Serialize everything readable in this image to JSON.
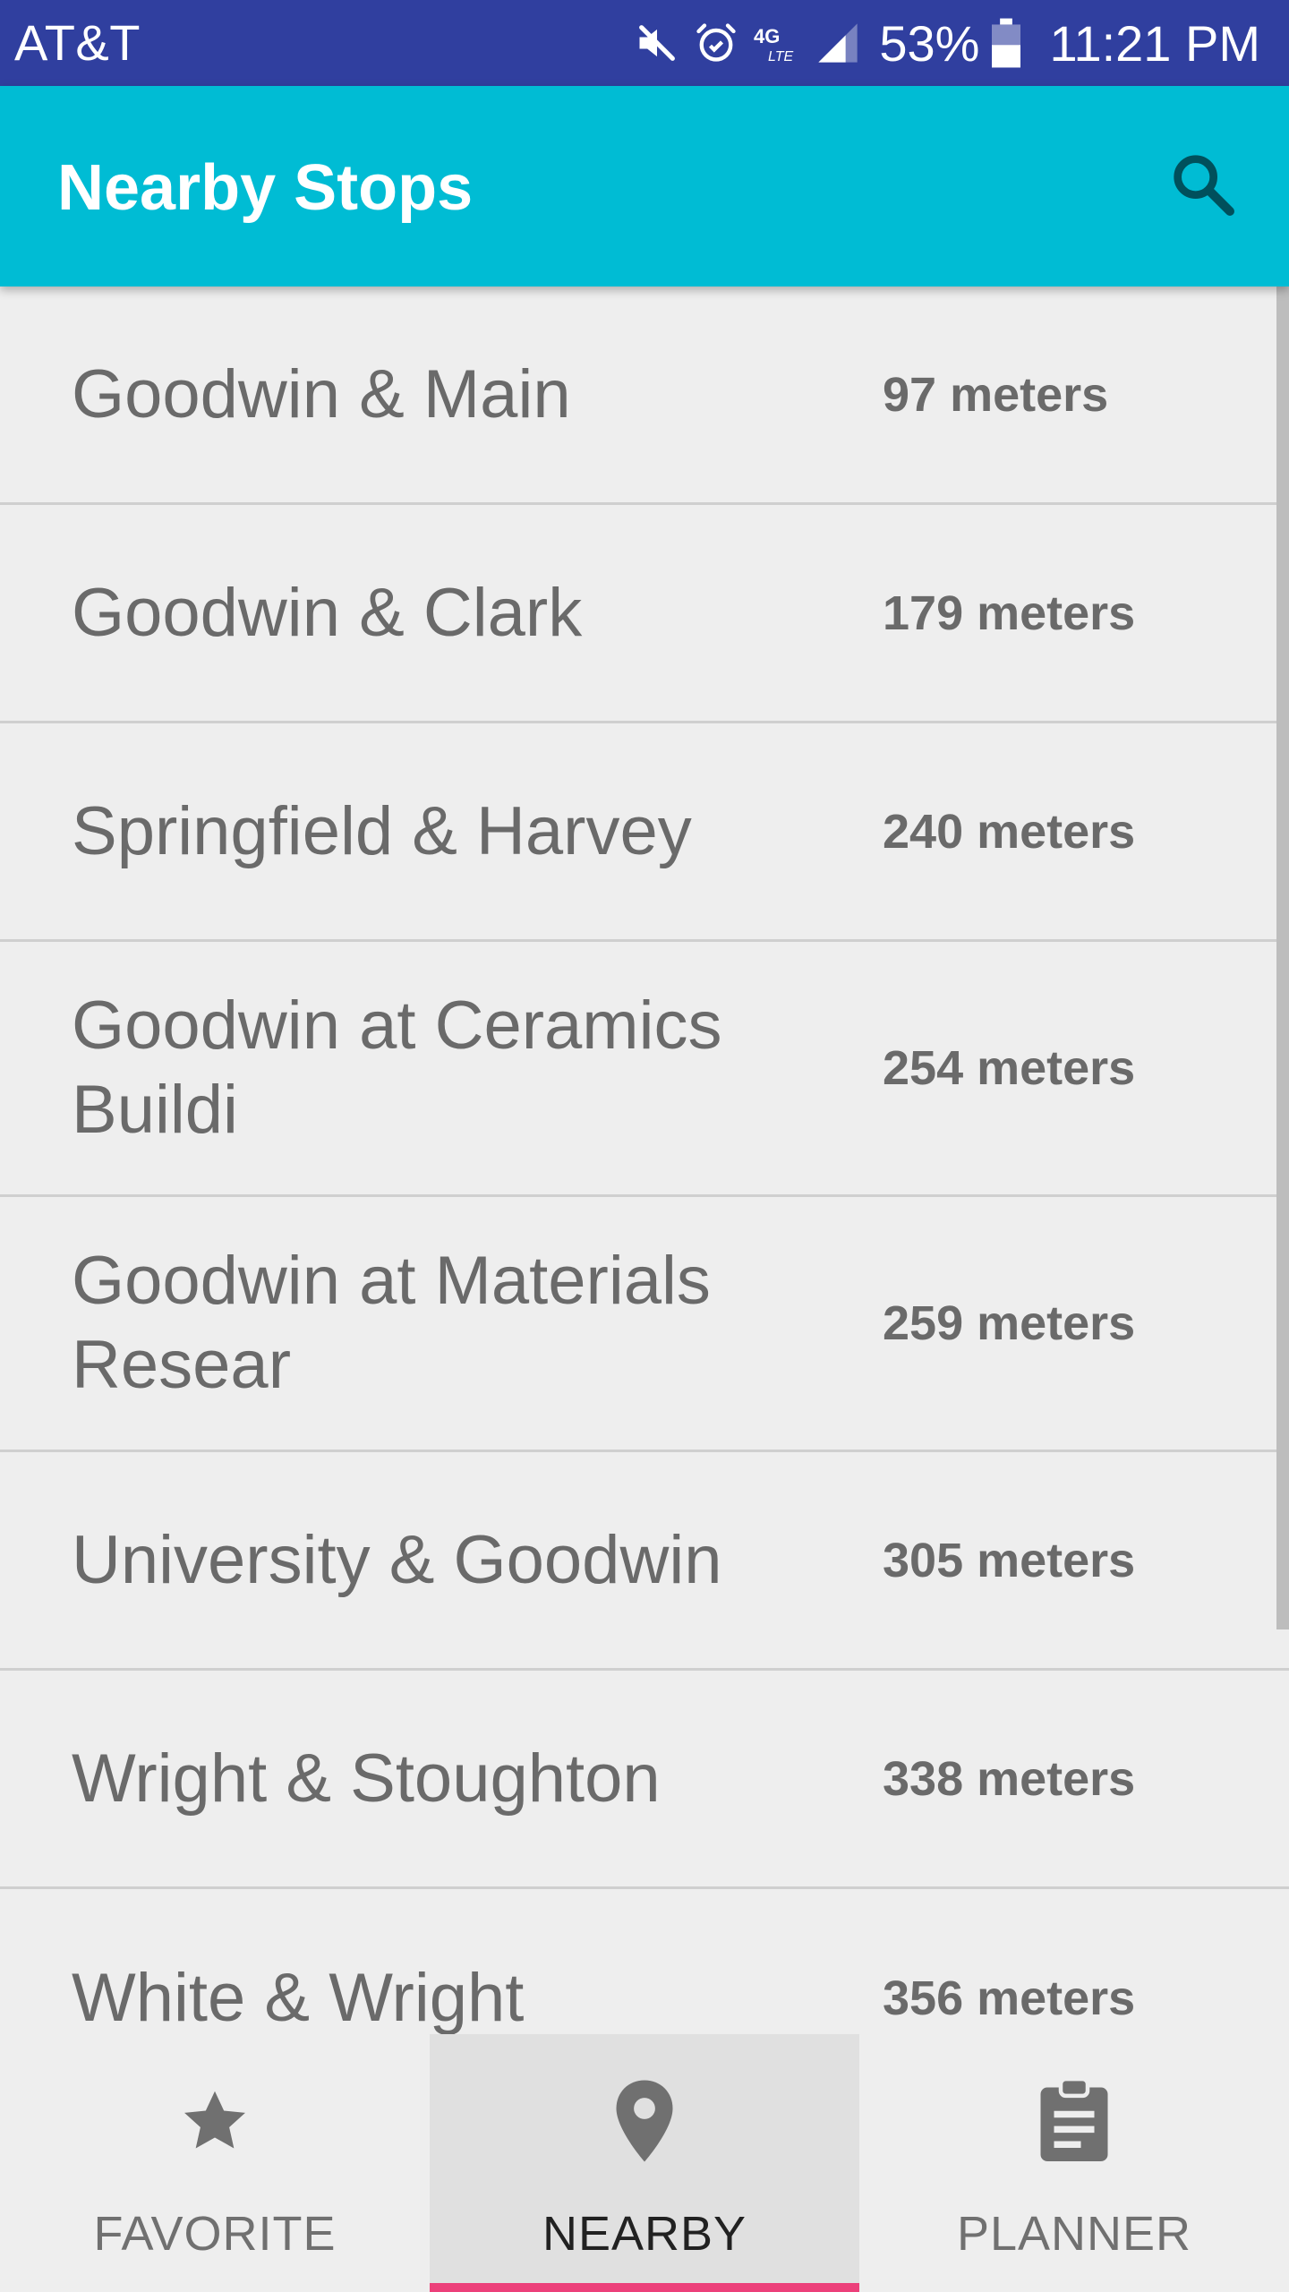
{
  "status_bar": {
    "carrier": "AT&T",
    "network": "4G LTE",
    "battery": "53%",
    "time": "11:21 PM",
    "icons": [
      "mute-icon",
      "alarm-icon",
      "lte-icon",
      "signal-icon",
      "battery-icon"
    ]
  },
  "app_bar": {
    "title": "Nearby Stops",
    "search_icon": "search-icon"
  },
  "stops": [
    {
      "name": "Goodwin & Main",
      "distance": "97 meters"
    },
    {
      "name": "Goodwin & Clark",
      "distance": "179 meters"
    },
    {
      "name": "Springfield & Harvey",
      "distance": "240 meters"
    },
    {
      "name": "Goodwin at Ceramics Buildi",
      "distance": "254 meters"
    },
    {
      "name": "Goodwin at Materials Resear",
      "distance": "259 meters"
    },
    {
      "name": "University & Goodwin",
      "distance": "305 meters"
    },
    {
      "name": "Wright & Stoughton",
      "distance": "338 meters"
    },
    {
      "name": "White & Wright",
      "distance": "356 meters"
    }
  ],
  "bottom_nav": {
    "items": [
      {
        "label": "FAVORITE",
        "icon": "star-icon"
      },
      {
        "label": "NEARBY",
        "icon": "location-pin-icon",
        "active": true
      },
      {
        "label": "PLANNER",
        "icon": "clipboard-icon"
      }
    ]
  },
  "colors": {
    "status_bar": "#303f9f",
    "app_bar": "#00bcd4",
    "active_indicator": "#ec407a"
  }
}
